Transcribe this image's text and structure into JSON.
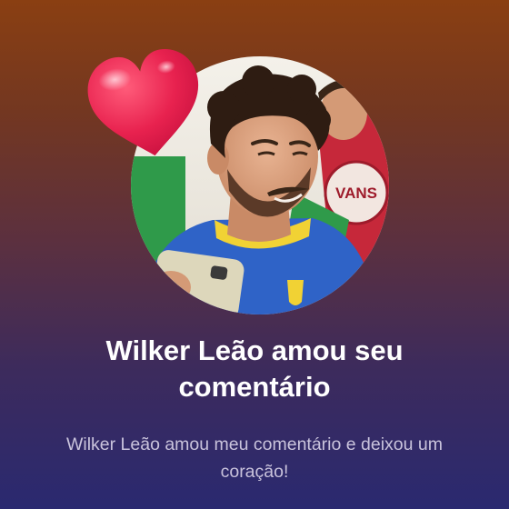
{
  "notification": {
    "title": "Wilker Leão amou seu comentário",
    "message": "Wilker Leão amou meu comentário e deixou um coração!",
    "reaction_icon": "heart-icon",
    "accent_color": "#e8224f"
  },
  "avatar": {
    "shirt_print": "VANS"
  }
}
